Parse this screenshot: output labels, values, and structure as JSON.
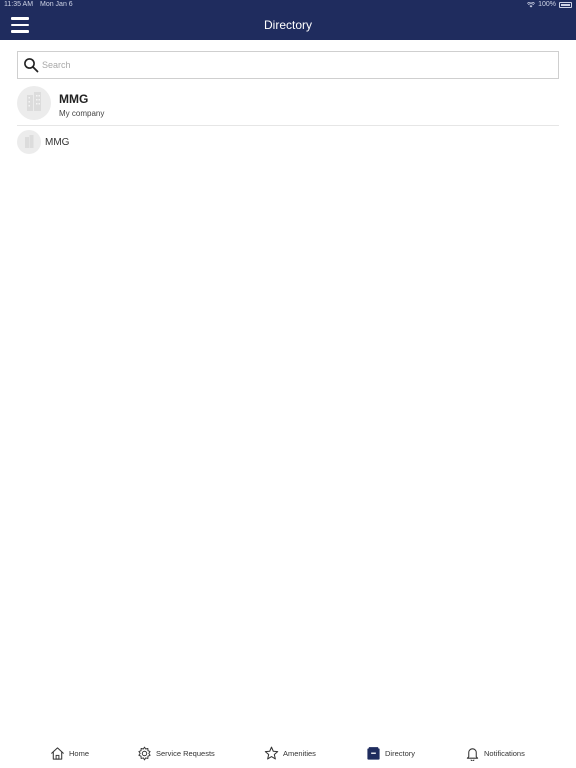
{
  "status_bar": {
    "time": "11:35 AM",
    "date": "Mon Jan 6",
    "battery": "100%"
  },
  "header": {
    "title": "Directory",
    "background_color": "#1f2c5e"
  },
  "search": {
    "placeholder": "Search",
    "value": ""
  },
  "directory": {
    "items": [
      {
        "title": "MMG",
        "subtitle": "My company"
      },
      {
        "title": "MMG"
      }
    ]
  },
  "tab_bar": {
    "tabs": [
      {
        "label": "Home",
        "icon": "home-icon"
      },
      {
        "label": "Service Requests",
        "icon": "gear-icon"
      },
      {
        "label": "Amenities",
        "icon": "star-icon"
      },
      {
        "label": "Directory",
        "icon": "directory-icon",
        "active": true
      },
      {
        "label": "Notifications",
        "icon": "bell-icon"
      }
    ]
  }
}
